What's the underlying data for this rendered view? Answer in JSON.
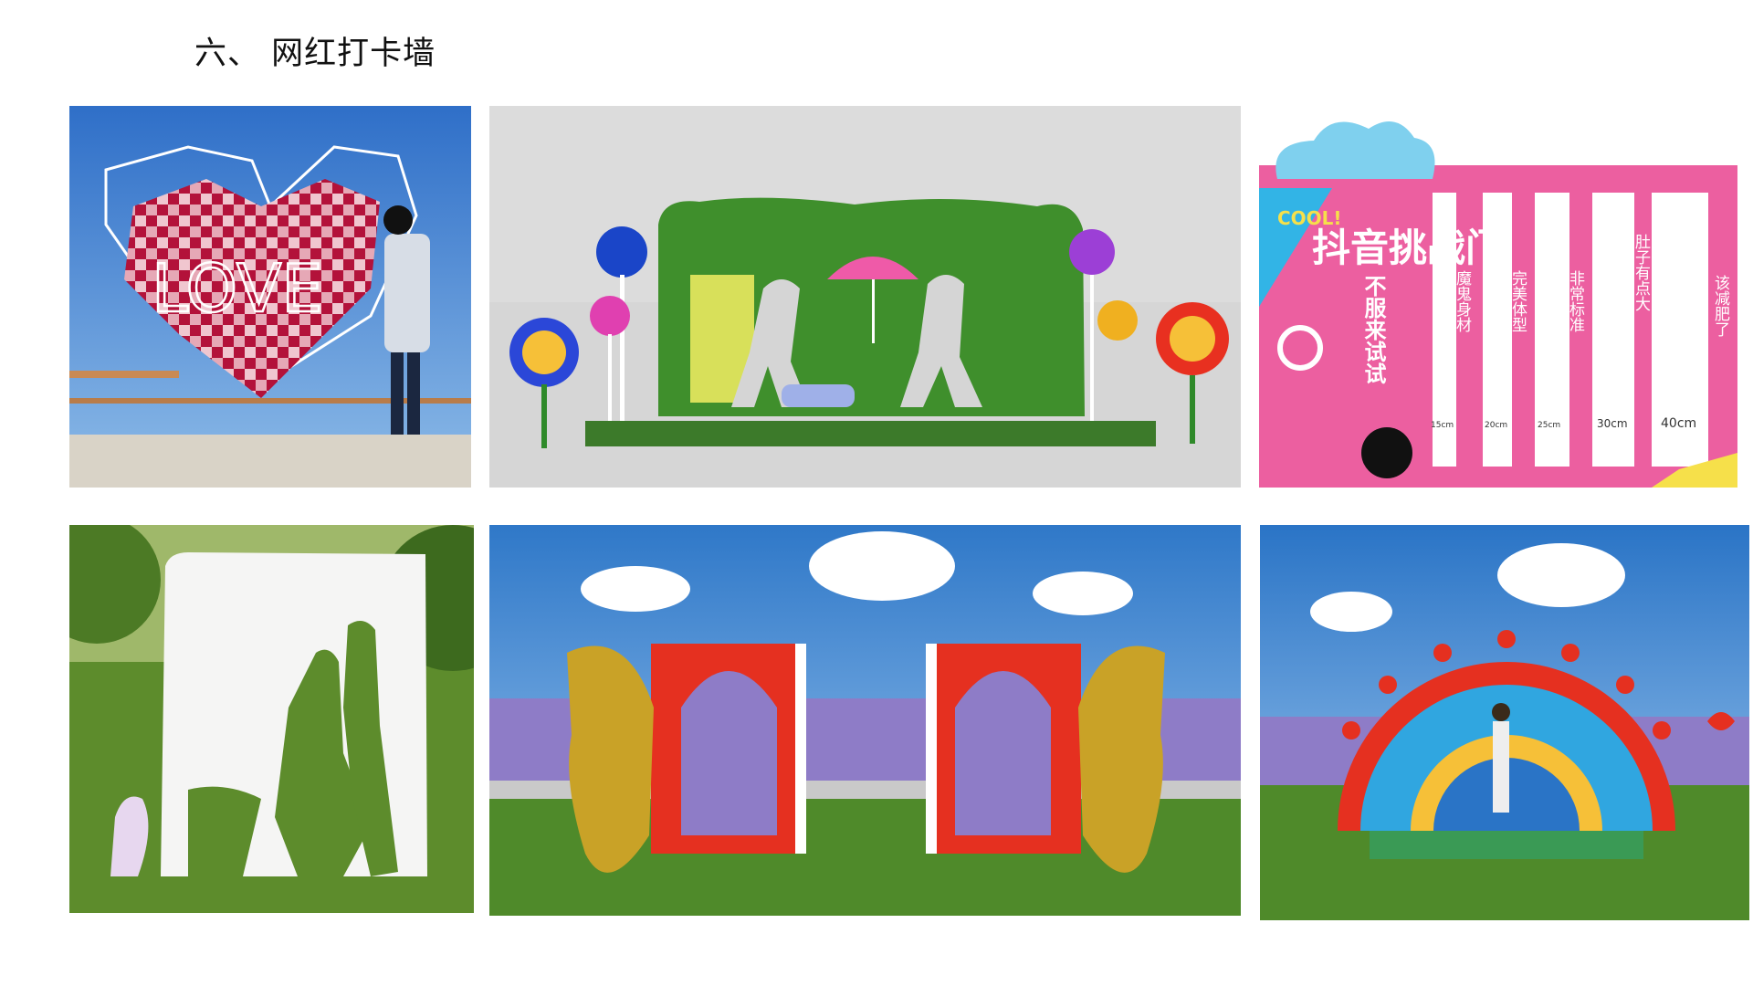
{
  "page": {
    "heading": "六、 网红打卡墙"
  },
  "photos": [
    {
      "subject": "pixel-heart-love-wall",
      "sign_text": "LOVE"
    },
    {
      "subject": "green-hedge-wall-rendering"
    },
    {
      "subject": "douyin-challenge-wall",
      "badge": "COOL!",
      "title": "抖音挑战门",
      "subtitle": "不服来试试",
      "side_text": "该减肥了",
      "slots": [
        {
          "label": "魔鬼身材",
          "width": "15cm"
        },
        {
          "label": "完美体型",
          "width": "20cm"
        },
        {
          "label": "非常标准",
          "width": "25cm"
        },
        {
          "label": "肚子有点大",
          "width": "30cm"
        },
        {
          "label": "",
          "width": "40cm"
        }
      ]
    },
    {
      "subject": "white-silhouette-wall"
    },
    {
      "subject": "butterfly-gate-lavender"
    },
    {
      "subject": "floral-arch-lavender"
    }
  ],
  "colors": {
    "heading": "#111111",
    "sky": "#3f7fd0",
    "grass": "#4f8a2a",
    "lavender": "#8e7cc7",
    "pink": "#ec5fa0",
    "red": "#e53020",
    "gold": "#c9a227"
  }
}
